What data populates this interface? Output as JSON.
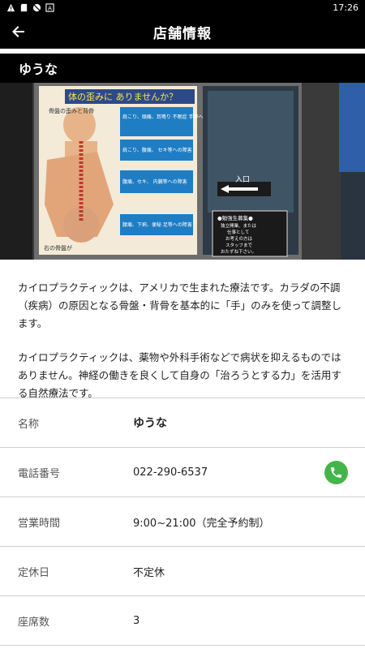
{
  "status_bar": {
    "time": "17:26",
    "icons": [
      "warning-icon",
      "sd-card-icon",
      "no-signal-icon",
      "app-a-icon"
    ]
  },
  "app_bar": {
    "title": "店舗情報",
    "back_icon": "arrow-left-icon"
  },
  "shop": {
    "name": "ゆうな"
  },
  "photo": {
    "sign_top": "体の歪みに ありませんか？",
    "sign_sub": "骨盤の歪みと背骨",
    "labels": [
      "肩こり、頭痛、耳鳴り 不眠症 手等への障害",
      "肩こり、腹痛、 セキ等への障害",
      "腹痛、セキ、 内臓等への障害",
      "腰痛、下痢、便秘 足等への障害"
    ],
    "entrance": "入口",
    "recruit": [
      "●勉強生募集●",
      "独立開業、または",
      "仕事として",
      "お考えの方は",
      "スタッフまで",
      "おたずね下さい。"
    ],
    "bottom_left": "右の骨盤が"
  },
  "description": {
    "p1": "カイロプラクティックは、アメリカで生まれた療法です。カラダの不調（疾病）の原因となる骨盤・背骨を基本的に「手」のみを使って調整します。",
    "p2": "カイロプラクティックは、薬物や外科手術などで病状を抑えるものではありません。神経の働きを良くして自身の「治ろうとする力」を活用する自然療法です。"
  },
  "info": {
    "name_label": "名称",
    "name_value": "ゆうな",
    "phone_label": "電話番号",
    "phone_value": "022-290-6537",
    "phone_icon": "phone-icon",
    "hours_label": "営業時間",
    "hours_value": "9:00~21:00（完全予約制）",
    "holiday_label": "定休日",
    "holiday_value": "不定休",
    "seats_label": "座席数",
    "seats_value": "3"
  },
  "colors": {
    "bar": "#000000",
    "phone_green": "#43b549",
    "divider": "#cfcfcf"
  }
}
